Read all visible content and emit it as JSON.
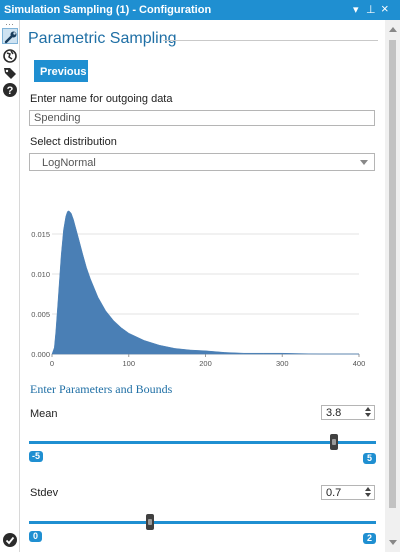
{
  "window": {
    "title": "Simulation Sampling (1) - Configuration",
    "controls": {
      "menu": "▾",
      "pin": "⊥",
      "close": "×"
    }
  },
  "toolstrip": {
    "items": [
      {
        "name": "wrench-icon",
        "selected": true
      },
      {
        "name": "globe-icon",
        "selected": false
      },
      {
        "name": "tag-icon",
        "selected": false
      },
      {
        "name": "help-icon",
        "selected": false
      }
    ],
    "bottom": "checkmark-icon"
  },
  "panel": {
    "heading": "Parametric Sampling",
    "previous_label": "Previous",
    "outgoing_label": "Enter name for outgoing data",
    "outgoing_value": "Spending",
    "distribution_label": "Select distribution",
    "distribution_value": "LogNormal"
  },
  "chart_data": {
    "type": "area",
    "title": "",
    "xlabel": "",
    "ylabel": "",
    "xlim": [
      0,
      400
    ],
    "ylim": [
      0,
      0.02
    ],
    "x_ticks": [
      "0",
      "100",
      "200",
      "300",
      "400"
    ],
    "y_ticks": [
      "0.000",
      "0.005",
      "0.010",
      "0.015"
    ],
    "grid": "horizontal",
    "legend": "none",
    "color": "#4a7fb5",
    "x": [
      0,
      3,
      5,
      8,
      10,
      12,
      15,
      18,
      20,
      22,
      25,
      28,
      30,
      35,
      40,
      45,
      50,
      60,
      70,
      80,
      90,
      100,
      120,
      140,
      160,
      180,
      200,
      225,
      250,
      275,
      300,
      350,
      400
    ],
    "y": [
      0.0,
      0.0008,
      0.0028,
      0.0068,
      0.0097,
      0.0124,
      0.0155,
      0.0172,
      0.0178,
      0.0179,
      0.0176,
      0.0168,
      0.0161,
      0.0143,
      0.0125,
      0.0108,
      0.0094,
      0.0071,
      0.0054,
      0.0042,
      0.0033,
      0.0026,
      0.0017,
      0.0011,
      0.0007,
      0.0005,
      0.0004,
      0.0002,
      0.0001,
      0.0001,
      0.0001,
      0.0,
      0.0
    ]
  },
  "params": {
    "heading": "Enter Parameters and Bounds",
    "mean": {
      "label": "Mean",
      "value": "3.8",
      "min": "-5",
      "max": "5",
      "level": 3.8
    },
    "stdev": {
      "label": "Stdev",
      "value": "0.7",
      "min": "0",
      "max": "2",
      "level": 0.7
    }
  },
  "accent_color": "#1f8fd1"
}
